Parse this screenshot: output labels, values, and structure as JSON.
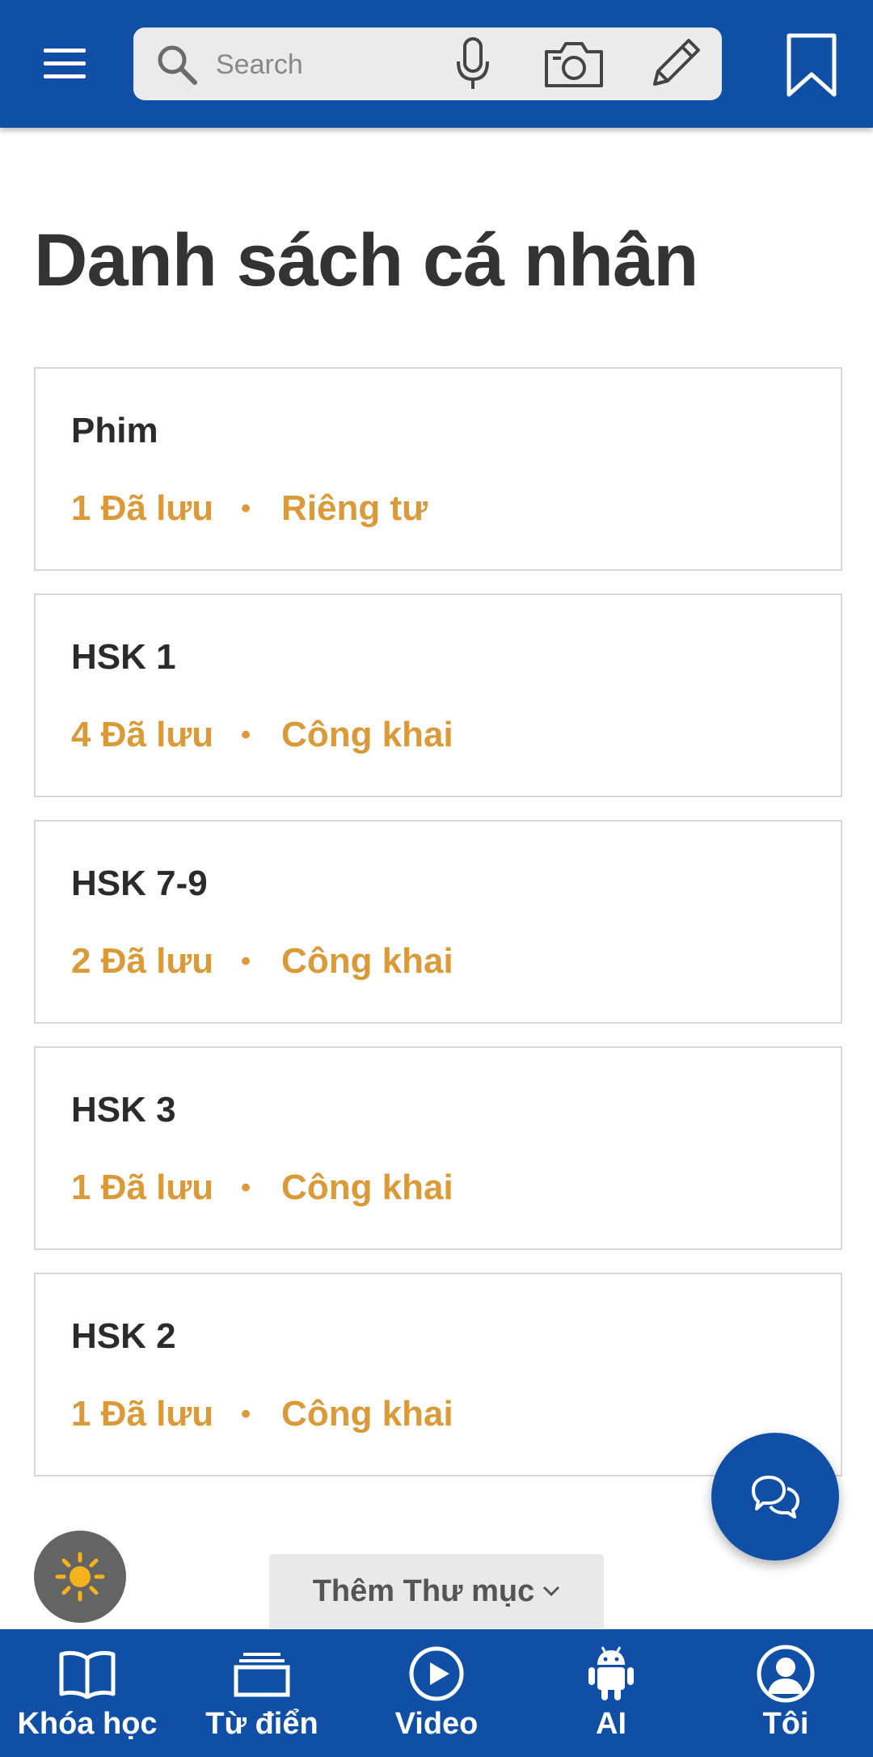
{
  "header": {
    "menu_icon": "hamburger-menu-icon",
    "search": {
      "placeholder": "Search",
      "value": ""
    },
    "icons": [
      "search-icon",
      "microphone-icon",
      "camera-icon",
      "pencil-icon",
      "bookmark-icon"
    ]
  },
  "page": {
    "title": "Danh sách cá nhân"
  },
  "lists": [
    {
      "name": "Phim",
      "count": "1 Đã lưu",
      "visibility": "Riêng tư"
    },
    {
      "name": "HSK 1",
      "count": "4 Đã lưu",
      "visibility": "Công khai"
    },
    {
      "name": "HSK 7-9",
      "count": "2 Đã lưu",
      "visibility": "Công khai"
    },
    {
      "name": "HSK 3",
      "count": "1 Đã lưu",
      "visibility": "Công khai"
    },
    {
      "name": "HSK 2",
      "count": "1 Đã lưu",
      "visibility": "Công khai"
    }
  ],
  "meta_separator": "•",
  "add_folder": {
    "label": "Thêm Thư mục"
  },
  "nav": {
    "items": [
      {
        "label": "Khóa học",
        "icon": "book-icon"
      },
      {
        "label": "Từ điển",
        "icon": "cards-icon"
      },
      {
        "label": "Video",
        "icon": "play-icon"
      },
      {
        "label": "AI",
        "icon": "android-icon"
      },
      {
        "label": "Tôi",
        "icon": "user-icon"
      }
    ]
  },
  "colors": {
    "primary": "#0f50a6",
    "accent": "#d99a37",
    "text": "#333333",
    "border": "#d7d7d7"
  }
}
